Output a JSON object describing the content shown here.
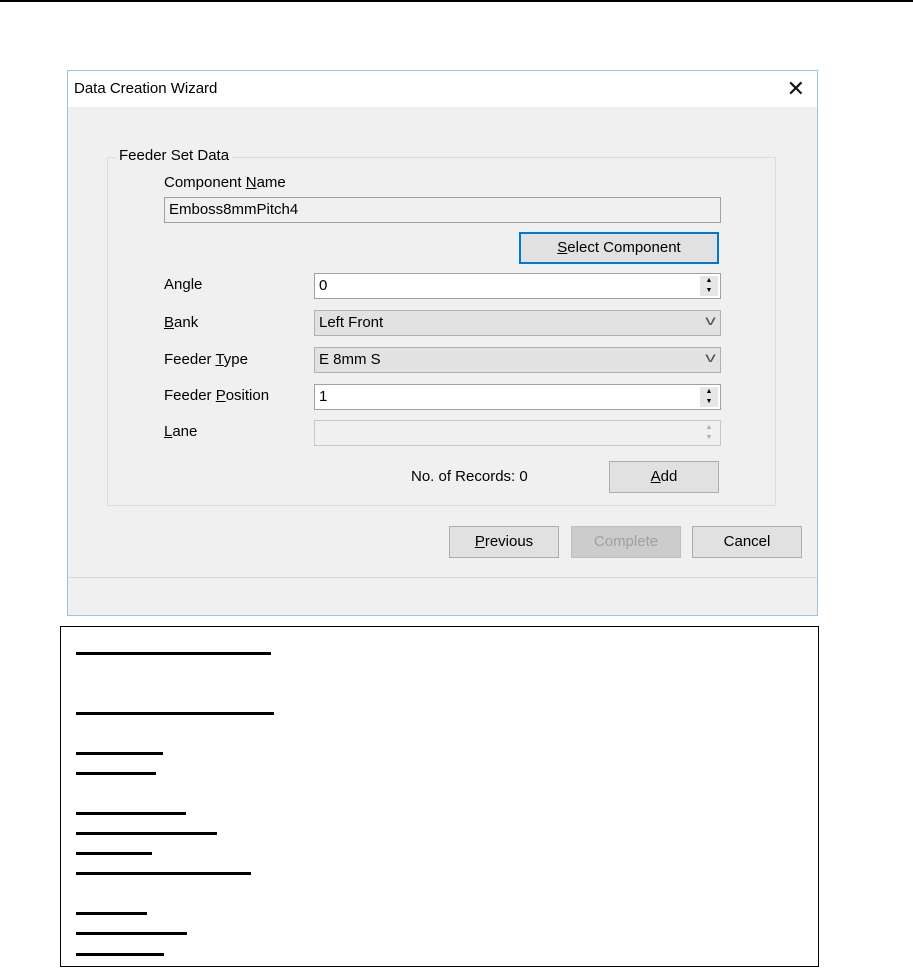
{
  "dialog": {
    "title": "Data Creation Wizard",
    "close_icon": "close-icon",
    "group_label": "Feeder Set Data",
    "component_name": {
      "label": {
        "pre": "Component ",
        "key": "N",
        "post": "ame"
      },
      "value": "Emboss8mmPitch4"
    },
    "select_component": {
      "pre": "",
      "key": "S",
      "post": "elect Component"
    },
    "angle": {
      "label": {
        "pre": "An",
        "key": "g",
        "post": "le"
      },
      "value": "0"
    },
    "bank": {
      "label": {
        "pre": "",
        "key": "B",
        "post": "ank"
      },
      "value": "Left Front"
    },
    "feeder_type": {
      "label": {
        "pre": "Feeder ",
        "key": "T",
        "post": "ype"
      },
      "value": "E 8mm S"
    },
    "feeder_position": {
      "label": {
        "pre": "Feeder ",
        "key": "P",
        "post": "osition"
      },
      "value": "1"
    },
    "lane": {
      "label": {
        "pre": "",
        "key": "L",
        "post": "ane"
      },
      "value": ""
    },
    "records": "No. of Records: 0",
    "add": {
      "pre": "",
      "key": "A",
      "post": "dd"
    },
    "previous": {
      "pre": "",
      "key": "P",
      "post": "revious"
    },
    "complete": "Complete",
    "cancel": "Cancel",
    "accent_color": "#0078d7"
  }
}
